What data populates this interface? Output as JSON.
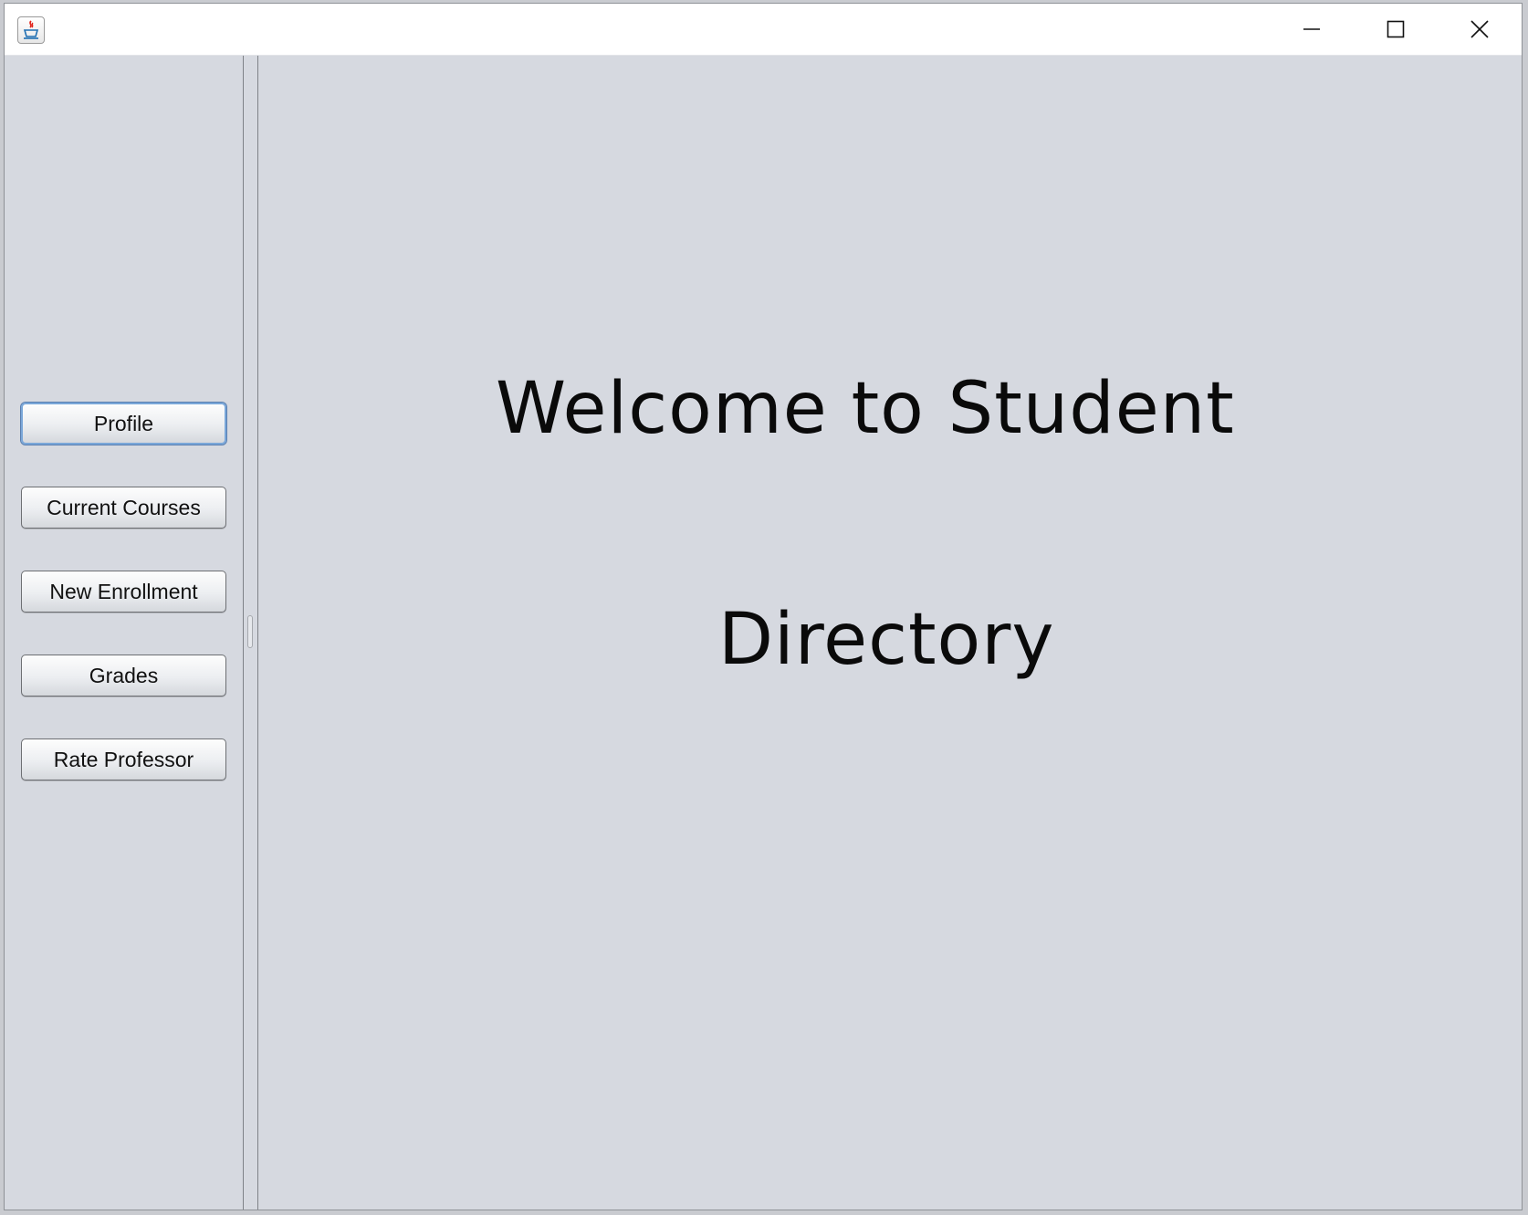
{
  "window": {
    "app_icon": "java-cup-icon",
    "controls": {
      "minimize_icon": "minimize-icon",
      "maximize_icon": "maximize-icon",
      "close_icon": "close-icon"
    }
  },
  "sidebar": {
    "buttons": [
      {
        "label": "Profile",
        "focused": true
      },
      {
        "label": "Current Courses"
      },
      {
        "label": "New Enrollment"
      },
      {
        "label": "Grades"
      },
      {
        "label": "Rate Professor"
      }
    ]
  },
  "main": {
    "welcome_line1": "Welcome to Student",
    "welcome_line2": "Directory"
  },
  "colors": {
    "panel_background": "#d6d9e0",
    "titlebar_background": "#ffffff",
    "focus_ring": "#7aa7d9"
  }
}
